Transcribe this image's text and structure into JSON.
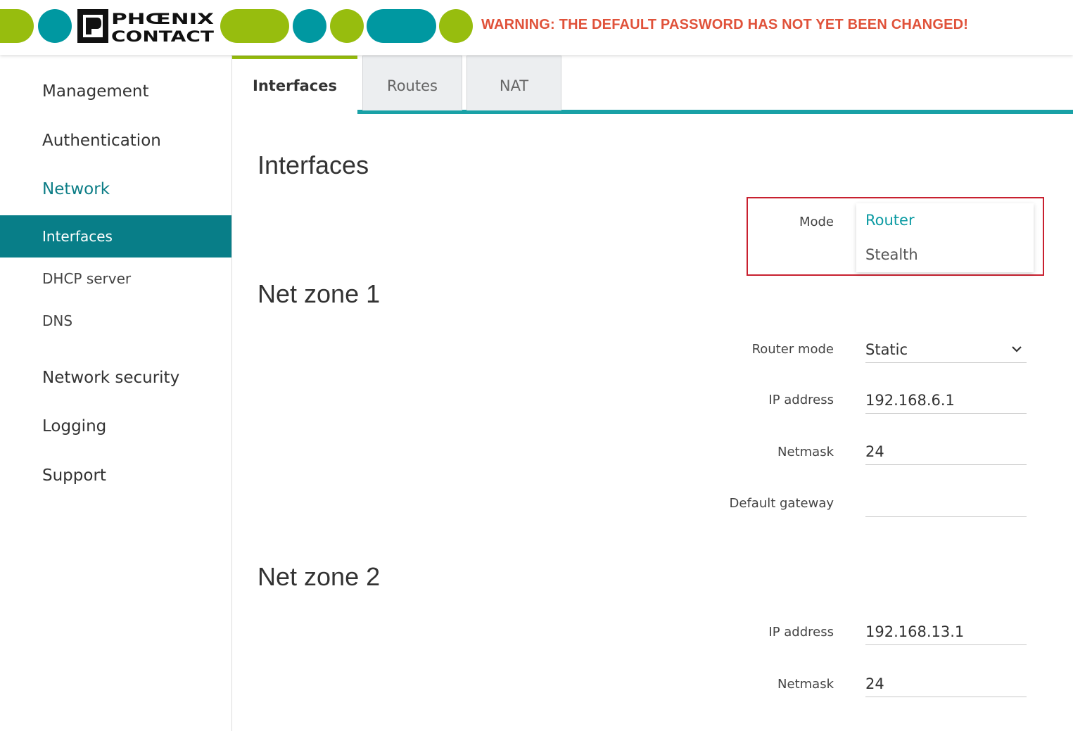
{
  "header": {
    "brand": "PHOENIX CONTACT",
    "warning": "WARNING: THE DEFAULT PASSWORD HAS NOT YET BEEN CHANGED!",
    "colors": {
      "green": "#97bd0e",
      "teal": "#0098a1",
      "warning": "#e0523a"
    }
  },
  "sidebar": {
    "items": [
      {
        "label": "Management"
      },
      {
        "label": "Authentication"
      },
      {
        "label": "Network"
      },
      {
        "label": "Interfaces"
      },
      {
        "label": "DHCP server"
      },
      {
        "label": "DNS"
      },
      {
        "label": "Network security"
      },
      {
        "label": "Logging"
      },
      {
        "label": "Support"
      }
    ]
  },
  "tabs": [
    {
      "label": "Interfaces"
    },
    {
      "label": "Routes"
    },
    {
      "label": "NAT"
    }
  ],
  "main": {
    "title": "Interfaces",
    "mode": {
      "label": "Mode",
      "options": [
        "Router",
        "Stealth"
      ],
      "selected": "Router"
    },
    "zone1": {
      "title": "Net zone 1",
      "router_mode_label": "Router mode",
      "router_mode_value": "Static",
      "ip_label": "IP address",
      "ip_value": "192.168.6.1",
      "netmask_label": "Netmask",
      "netmask_value": "24",
      "gateway_label": "Default gateway",
      "gateway_value": ""
    },
    "zone2": {
      "title": "Net zone 2",
      "ip_label": "IP address",
      "ip_value": "192.168.13.1",
      "netmask_label": "Netmask",
      "netmask_value": "24"
    }
  }
}
